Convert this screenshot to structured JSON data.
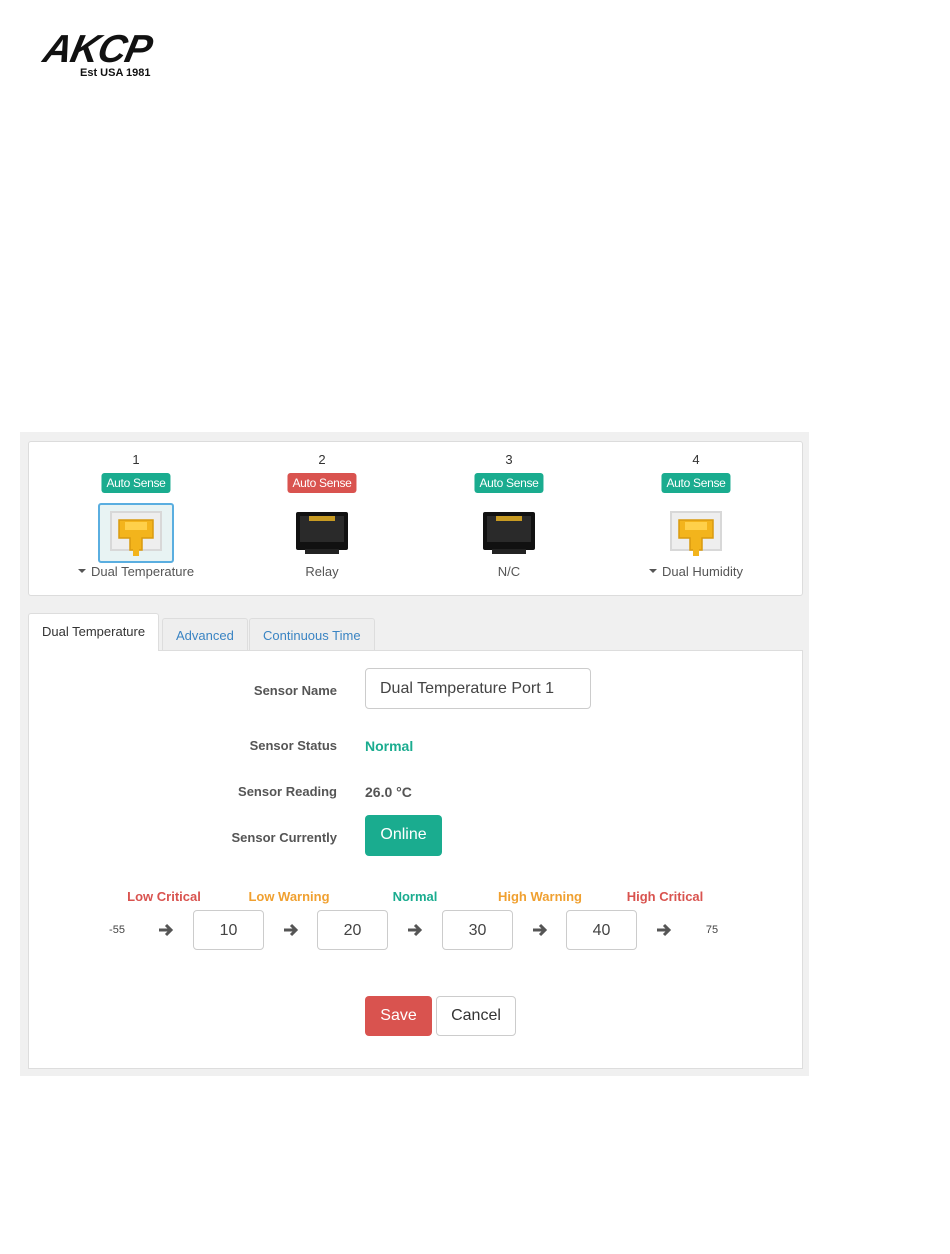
{
  "logo": {
    "word": "AKCP",
    "subtitle": "Est USA 1981"
  },
  "ports": [
    {
      "number": "1",
      "badge": "Auto Sense",
      "badge_status": "ok",
      "plugged": true,
      "selected": true,
      "has_menu": true,
      "label": "Dual Temperature"
    },
    {
      "number": "2",
      "badge": "Auto Sense",
      "badge_status": "bad",
      "plugged": false,
      "selected": false,
      "has_menu": false,
      "label": "Relay"
    },
    {
      "number": "3",
      "badge": "Auto Sense",
      "badge_status": "ok",
      "plugged": false,
      "selected": false,
      "has_menu": false,
      "label": "N/C"
    },
    {
      "number": "4",
      "badge": "Auto Sense",
      "badge_status": "ok",
      "plugged": true,
      "selected": false,
      "has_menu": true,
      "label": "Dual Humidity"
    }
  ],
  "tabs": [
    {
      "label": "Dual Temperature",
      "active": true
    },
    {
      "label": "Advanced",
      "active": false
    },
    {
      "label": "Continuous Time",
      "active": false
    }
  ],
  "form": {
    "sensor_name_label": "Sensor Name",
    "sensor_name_value": "Dual Temperature Port 1",
    "sensor_status_label": "Sensor Status",
    "sensor_status_value": "Normal",
    "sensor_reading_label": "Sensor Reading",
    "sensor_reading_value": "26.0 °C",
    "sensor_currently_label": "Sensor Currently",
    "sensor_currently_value": "Online"
  },
  "thresholds": {
    "labels": [
      "Low Critical",
      "Low Warning",
      "Normal",
      "High Warning",
      "High Critical"
    ],
    "min": "-55",
    "max": "75",
    "values": [
      "10",
      "20",
      "30",
      "40"
    ]
  },
  "actions": {
    "save": "Save",
    "cancel": "Cancel"
  },
  "colors": {
    "accent_green": "#1aac8f",
    "danger_red": "#d9534f",
    "warning_orange": "#f0a030",
    "link_blue": "#3a84c3"
  }
}
